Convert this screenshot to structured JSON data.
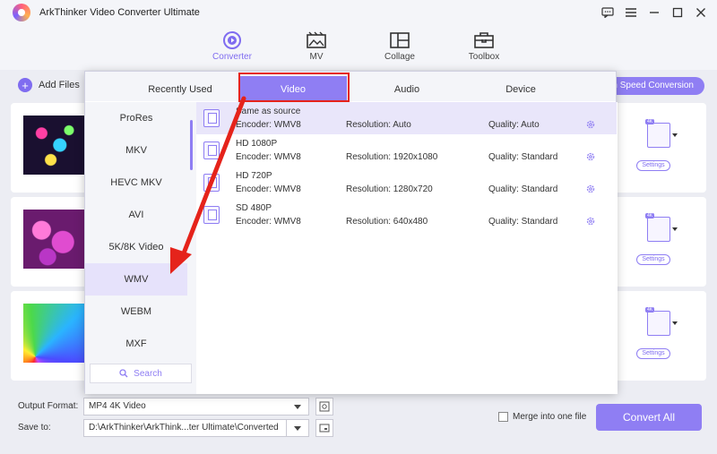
{
  "app": {
    "title": "ArkThinker Video Converter Ultimate"
  },
  "nav": {
    "items": [
      {
        "label": "Converter",
        "icon": "converter-icon",
        "active": true
      },
      {
        "label": "MV",
        "icon": "mv-icon",
        "active": false
      },
      {
        "label": "Collage",
        "icon": "collage-icon",
        "active": false
      },
      {
        "label": "Toolbox",
        "icon": "toolbox-icon",
        "active": false
      }
    ]
  },
  "toolbar": {
    "add_files_label": "Add Files",
    "speed_label": "High Speed Conversion"
  },
  "rows": [
    {
      "settings_label": "Settings",
      "format_badge": "4K"
    },
    {
      "settings_label": "Settings",
      "format_badge": "4K"
    },
    {
      "settings_label": "Settings",
      "format_badge": "4K"
    }
  ],
  "popup": {
    "tabs": [
      "Recently Used",
      "Video",
      "Audio",
      "Device"
    ],
    "active_tab": "Video",
    "formats": [
      "ProRes",
      "MKV",
      "HEVC MKV",
      "AVI",
      "5K/8K Video",
      "WMV",
      "WEBM",
      "MXF"
    ],
    "active_format": "WMV",
    "search_label": "Search",
    "presets": [
      {
        "name": "Same as source",
        "encoder": "Encoder: WMV8",
        "resolution": "Resolution: Auto",
        "quality": "Quality: Auto",
        "selected": true
      },
      {
        "name": "HD 1080P",
        "encoder": "Encoder: WMV8",
        "resolution": "Resolution: 1920x1080",
        "quality": "Quality: Standard",
        "selected": false
      },
      {
        "name": "HD 720P",
        "encoder": "Encoder: WMV8",
        "resolution": "Resolution: 1280x720",
        "quality": "Quality: Standard",
        "selected": false
      },
      {
        "name": "SD 480P",
        "encoder": "Encoder: WMV8",
        "resolution": "Resolution: 640x480",
        "quality": "Quality: Standard",
        "selected": false
      }
    ]
  },
  "bottom": {
    "output_format_label": "Output Format:",
    "output_format_value": "MP4 4K Video",
    "save_to_label": "Save to:",
    "save_to_value": "D:\\ArkThinker\\ArkThink...ter Ultimate\\Converted",
    "merge_label": "Merge into one file",
    "convert_all_label": "Convert All"
  },
  "colors": {
    "accent": "#8f7ef3",
    "highlight_box": "#e5231b",
    "annotation_arrow": "#e5231b"
  }
}
